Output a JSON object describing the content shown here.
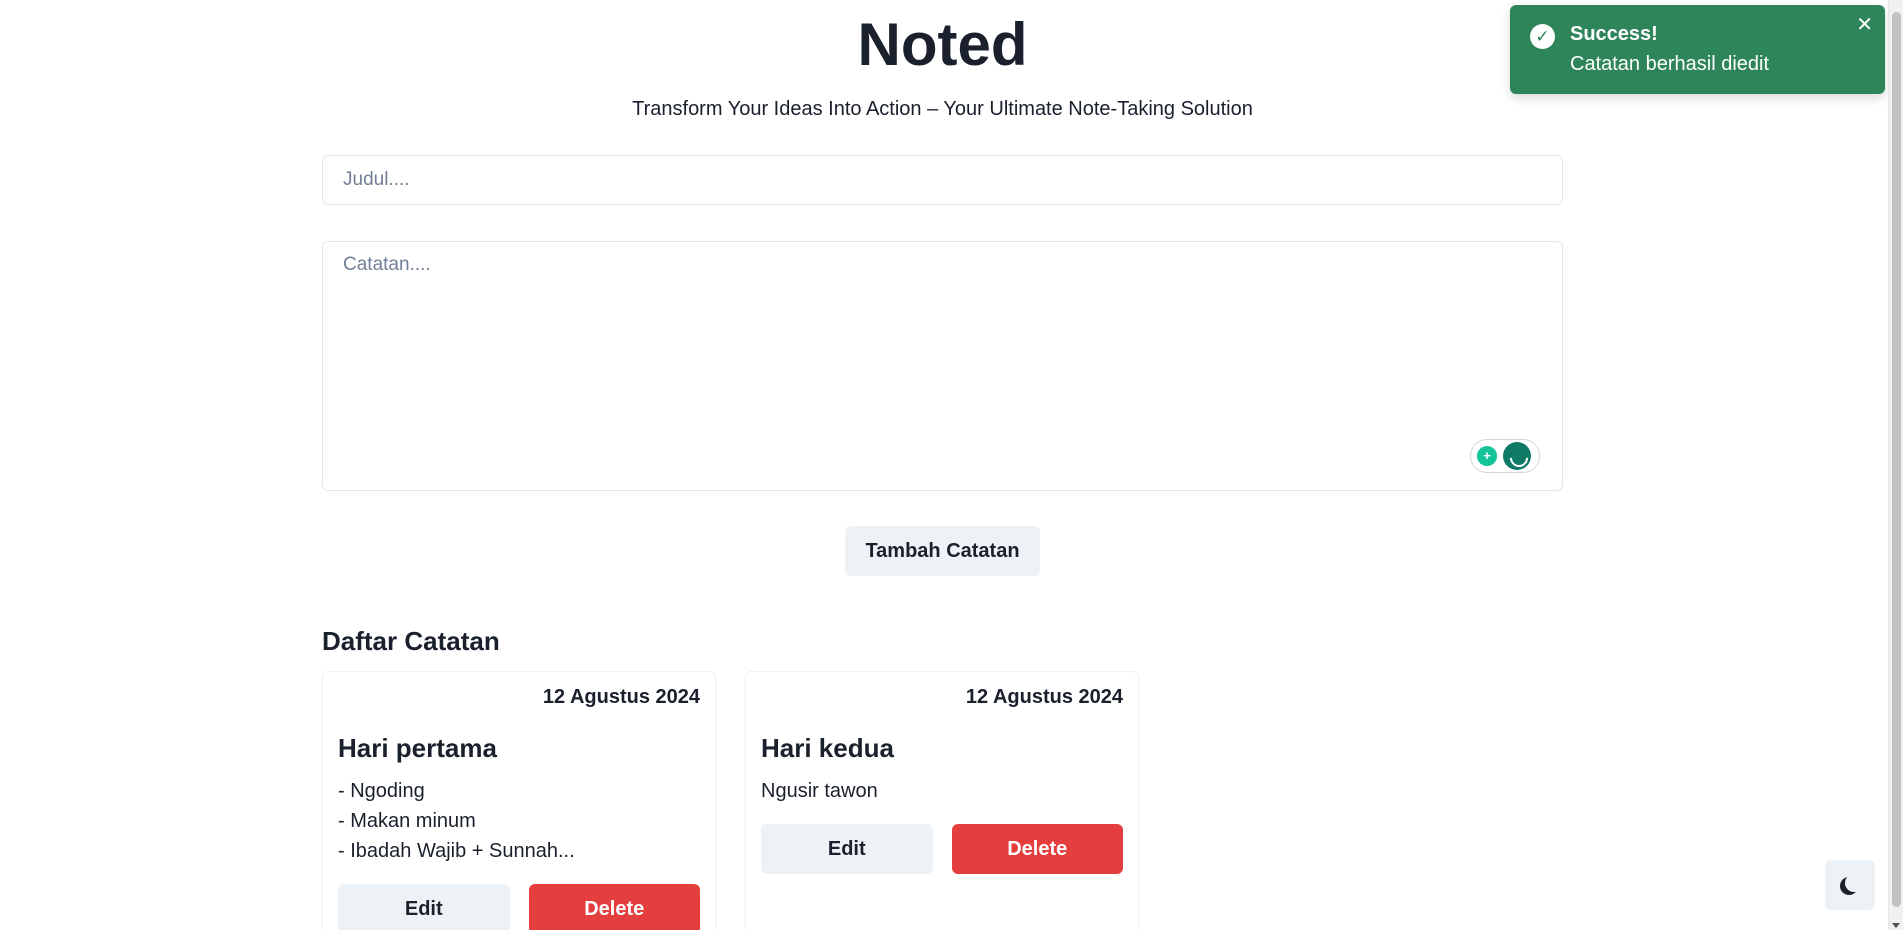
{
  "header": {
    "title": "Noted",
    "subtitle": "Transform Your Ideas Into Action – Your Ultimate Note-Taking Solution"
  },
  "form": {
    "title_placeholder": "Judul....",
    "title_value": "",
    "note_placeholder": "Catatan....",
    "note_value": "",
    "add_label": "Tambah Catatan"
  },
  "notes_section": {
    "heading": "Daftar Catatan",
    "notes": [
      {
        "date": "12 Agustus 2024",
        "title": "Hari pertama",
        "body_lines": [
          "- Ngoding",
          "- Makan minum",
          "- Ibadah Wajib + Sunnah..."
        ],
        "edit_label": "Edit",
        "delete_label": "Delete"
      },
      {
        "date": "12 Agustus 2024",
        "title": "Hari kedua",
        "body_lines": [
          "Ngusir tawon"
        ],
        "edit_label": "Edit",
        "delete_label": "Delete"
      }
    ]
  },
  "toast": {
    "title": "Success!",
    "description": "Catatan berhasil diedit",
    "status": "success",
    "color": "#2f855a",
    "icon": "check-circle-icon",
    "close_icon": "close-icon"
  },
  "theme_toggle": {
    "icon": "moon-icon"
  },
  "colors": {
    "text": "#1a202c",
    "delete": "#e53e3e",
    "neutral_button": "#edf2f7",
    "toast_success": "#2f855a"
  }
}
